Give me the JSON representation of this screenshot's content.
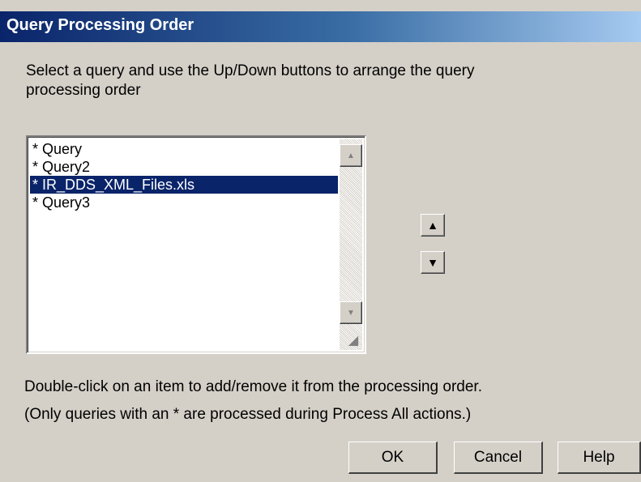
{
  "window": {
    "title": "Query Processing Order"
  },
  "instructions": "Select a query and use the Up/Down buttons to arrange the query processing order",
  "list": {
    "items": [
      {
        "label": "* Query",
        "selected": false
      },
      {
        "label": "* Query2",
        "selected": false
      },
      {
        "label": "* IR_DDS_XML_Files.xls",
        "selected": true
      },
      {
        "label": "* Query3",
        "selected": false
      }
    ],
    "selected_color": "#0a246a"
  },
  "icons": {
    "move_up": "triangle-up",
    "move_down": "triangle-down"
  },
  "hints": {
    "line1": "Double-click on an item to add/remove it from the processing order.",
    "line2": "(Only queries with an * are processed during Process All actions.)"
  },
  "buttons": {
    "ok": "OK",
    "cancel": "Cancel",
    "help": "Help"
  }
}
